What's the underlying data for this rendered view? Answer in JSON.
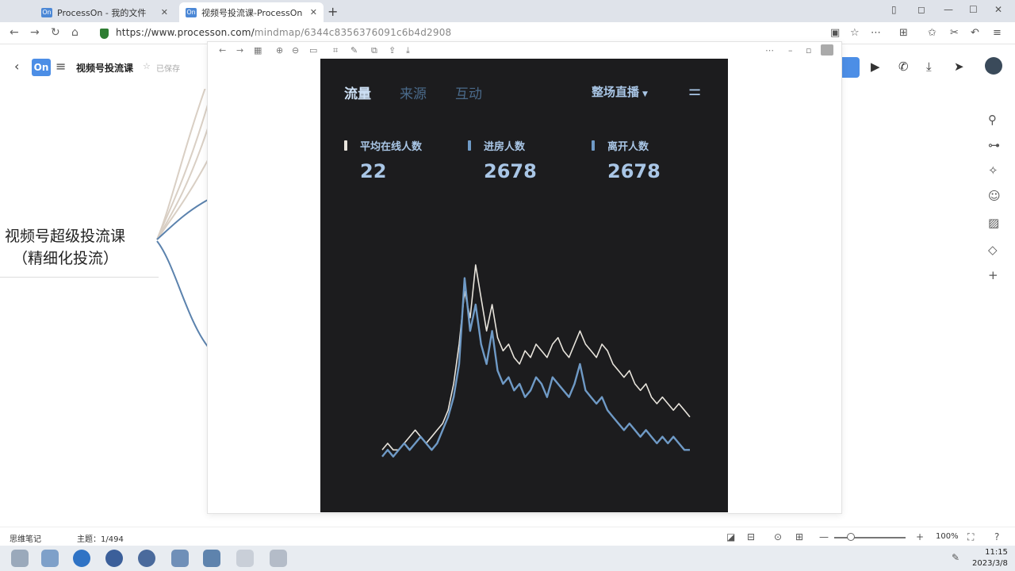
{
  "browser": {
    "tabs": [
      {
        "label": "ProcessOn - 我的文件",
        "favicon": "On"
      },
      {
        "label": "视频号投流课-ProcessOn",
        "favicon": "On"
      }
    ],
    "url_host": "https://www.processon.com/",
    "url_path": "mindmap/6344c8356376091c6b4d2908"
  },
  "app": {
    "logo": "On",
    "doc_title": "视频号投流课",
    "saved_status": "已保存"
  },
  "mindmap": {
    "root_line1": "视频号超级投流课",
    "root_line2": "（精细化投流）"
  },
  "dashboard": {
    "tabs": [
      "流量",
      "来源",
      "互动"
    ],
    "active_tab": "流量",
    "mode": "整场直播",
    "stats": [
      {
        "label": "平均在线人数",
        "value": "22",
        "color": "#e8e4dc"
      },
      {
        "label": "进房人数",
        "value": "2678",
        "color": "#6f9ac6"
      },
      {
        "label": "离开人数",
        "value": "2678",
        "color": "#6f9ac6"
      }
    ],
    "colors": {
      "background": "#1c1c1e",
      "accent": "#a9c6e6",
      "series_light": "#e8e4dc",
      "series_blue": "#6f9ac6"
    }
  },
  "chart_data": {
    "type": "line",
    "series": [
      {
        "values": [
          2,
          3,
          2,
          2,
          3,
          4,
          5,
          4,
          3,
          4,
          5,
          6,
          8,
          12,
          18,
          26,
          22,
          30,
          25,
          20,
          24,
          19,
          17,
          18,
          16,
          15,
          17,
          16,
          18,
          17,
          16,
          18,
          19,
          17,
          16,
          18,
          20,
          18,
          17,
          16,
          18,
          17,
          15,
          14,
          13,
          14,
          12,
          11,
          12,
          10,
          9,
          10,
          9,
          8,
          9,
          8,
          7
        ]
      },
      {
        "values": [
          1,
          2,
          1,
          2,
          3,
          2,
          3,
          4,
          3,
          2,
          3,
          5,
          7,
          10,
          15,
          28,
          20,
          24,
          18,
          15,
          20,
          14,
          12,
          13,
          11,
          12,
          10,
          11,
          13,
          12,
          10,
          13,
          12,
          11,
          10,
          12,
          15,
          11,
          10,
          9,
          10,
          8,
          7,
          6,
          5,
          6,
          5,
          4,
          5,
          4,
          3,
          4,
          3,
          4,
          3,
          2,
          2
        ]
      }
    ]
  },
  "sidebar_icons": [
    "connect-icon",
    "structure-icon",
    "sparkle-icon",
    "emoji-icon",
    "image-icon",
    "tag-icon",
    "plus-icon"
  ],
  "statusbar": {
    "notes_label": "思维笔记",
    "topic_label": "主题：1/494",
    "zoom": "100%"
  },
  "taskbar": {
    "time": "11:15",
    "date": "2023/3/8"
  }
}
